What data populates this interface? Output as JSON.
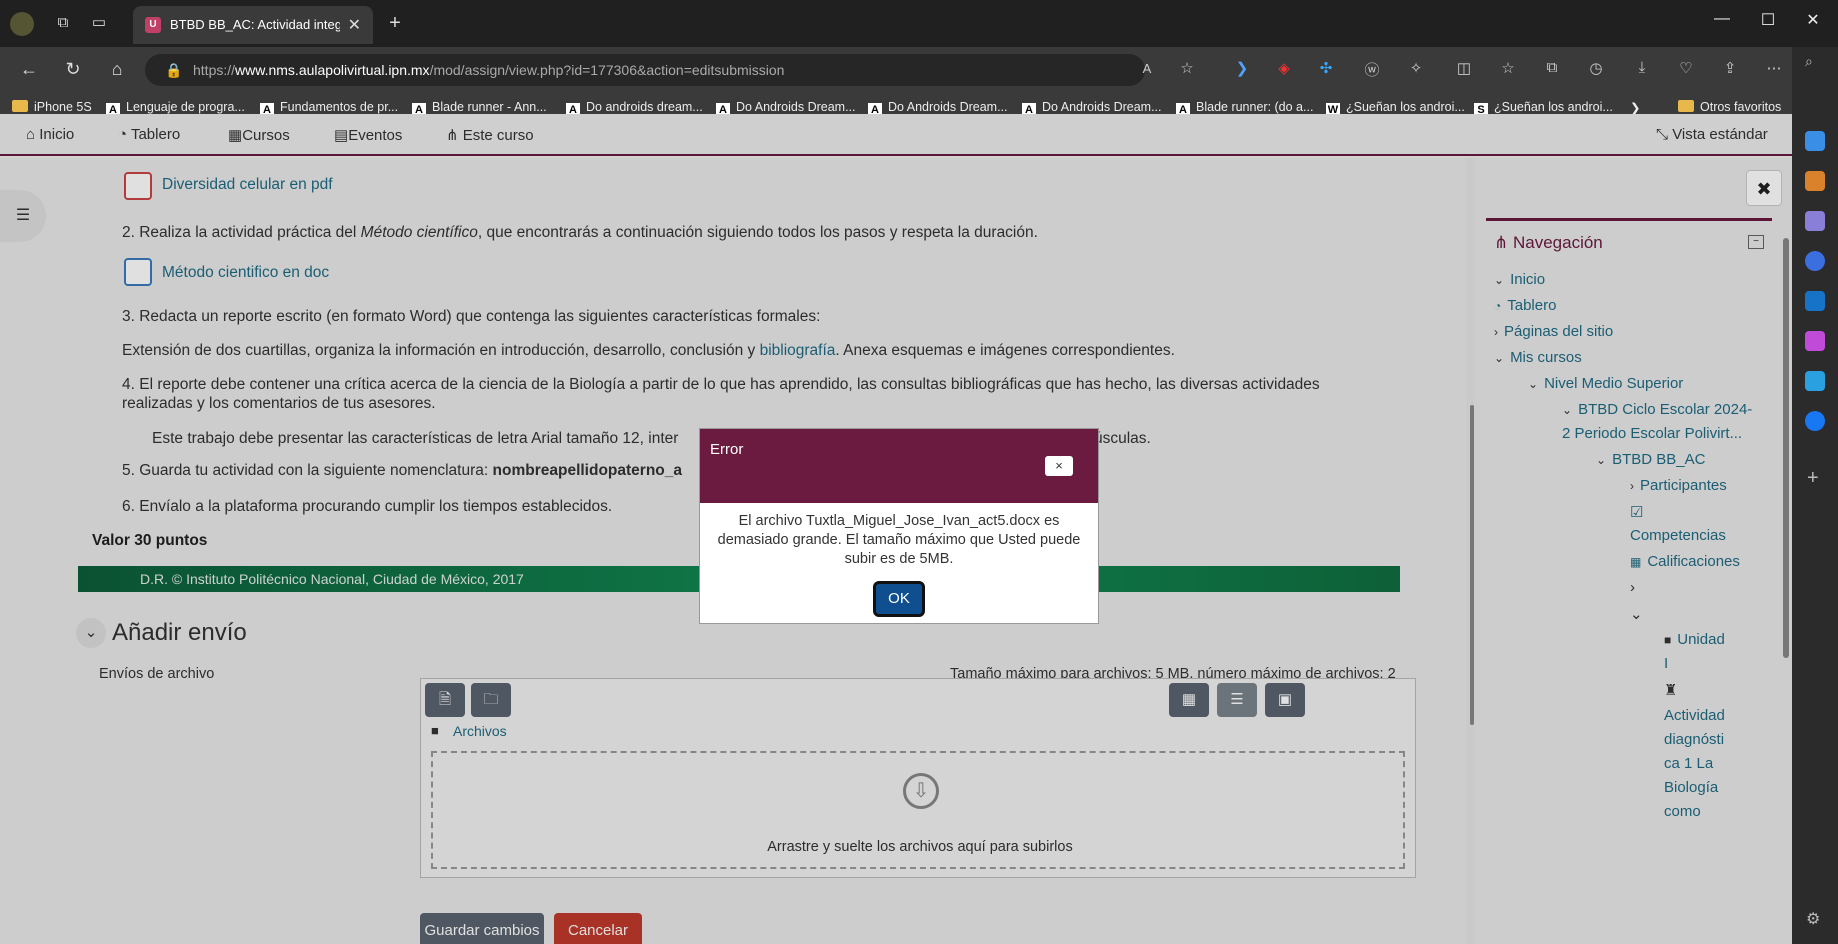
{
  "browser": {
    "tab_title": "BTBD BB_AC: Actividad integrado",
    "tab_icon_letter": "U",
    "url_prefix": "https://",
    "url_domain": "www.nms.aulapolivirtual.ipn.mx",
    "url_path": "/mod/assign/view.php?id=177306&action=editsubmission",
    "bookmarks": [
      {
        "label": "iPhone 5S",
        "icon": "folder-icon"
      },
      {
        "label": "Lenguaje de progra...",
        "icon": "A"
      },
      {
        "label": "Fundamentos de pr...",
        "icon": "A"
      },
      {
        "label": "Blade runner - Ann...",
        "icon": "A"
      },
      {
        "label": "Do androids dream...",
        "icon": "A"
      },
      {
        "label": "Do Androids Dream...",
        "icon": "A"
      },
      {
        "label": "Do Androids Dream...",
        "icon": "A"
      },
      {
        "label": "Do Androids Dream...",
        "icon": "A"
      },
      {
        "label": "Blade runner: (do a...",
        "icon": "A"
      },
      {
        "label": "¿Sueñan los androi...",
        "icon": "W"
      },
      {
        "label": "¿Sueñan los androi...",
        "icon": "S"
      }
    ],
    "other_favorites": "Otros favoritos"
  },
  "topnav": {
    "inicio": "Inicio",
    "tablero": "Tablero",
    "cursos": "Cursos",
    "eventos": "Eventos",
    "este_curso": "Este curso",
    "vista": "Vista estándar"
  },
  "content": {
    "link1": "Diversidad celular en pdf",
    "p2_a": "2. Realiza la actividad práctica del ",
    "p2_em": "Método científico",
    "p2_b": ", que encontrarás a continuación siguiendo todos los pasos y respeta la duración.",
    "link2": "Método cientifico en doc",
    "p3": "3. Redacta un reporte escrito (en formato Word) que contenga las siguientes características formales:",
    "p3b_a": "Extensión de dos cuartillas, organiza la información en introducción, desarrollo, conclusión y ",
    "p3b_link": "bibliografía",
    "p3b_b": ". Anexa esquemas e imágenes correspondientes.",
    "p4_l1": "4. El reporte debe contener una crítica acerca de la ciencia de la Biología a partir de lo que has aprendido, las consultas bibliográficas que has hecho, las diversas actividades",
    "p4_l2": "realizadas y los comentarios de tus asesores.",
    "p4b_a": "Este trabajo debe presentar las  características de letra Arial tamaño 12, inter",
    "p4b_b": "úsculas.",
    "p5_a": "5. Guarda tu actividad con la siguiente nomenclatura: ",
    "p5_b": "nombreapellidopaterno_a",
    "p6": "6. Envíalo a la plataforma procurando cumplir los tiempos establecidos.",
    "valor": "Valor 30 puntos",
    "footer_bar": "D.R. © Instituto Politécnico Nacional, Ciudad de México, 2017",
    "anadir": "Añadir envío",
    "envios_label": "Envíos de archivo",
    "limits": "Tamaño máximo para archivos: 5 MB, número máximo de archivos: 2",
    "archivos": "Archivos",
    "drop_text": "Arrastre y suelte los archivos aquí para subirlos",
    "guardar": "Guardar cambios",
    "cancelar": "Cancelar"
  },
  "nav": {
    "title": "Navegación",
    "items": [
      "Inicio",
      "Tablero",
      "Páginas del sitio",
      "Mis cursos",
      "Nivel Medio Superior",
      "BTBD Ciclo Escolar 2024-",
      "2 Periodo Escolar Polivirt...",
      "BTBD BB_AC",
      "Participantes",
      "Competencias",
      "Calificaciones",
      "Unidad",
      "I",
      "Actividad",
      "diagnósti",
      "ca 1 La",
      "Biología",
      "como"
    ]
  },
  "modal": {
    "title": "Error",
    "close": "×",
    "message": "El archivo Tuxtla_Miguel_Jose_Ivan_act5.docx es demasiado grande. El tamaño máximo que Usted puede subir es de 5MB.",
    "ok": "OK"
  },
  "colors": {
    "brand": "#6b1a40",
    "link": "#1f6b84",
    "ok_button": "#0f4f8f",
    "save_button": "#5a6570",
    "cancel_button": "#c0392b"
  }
}
